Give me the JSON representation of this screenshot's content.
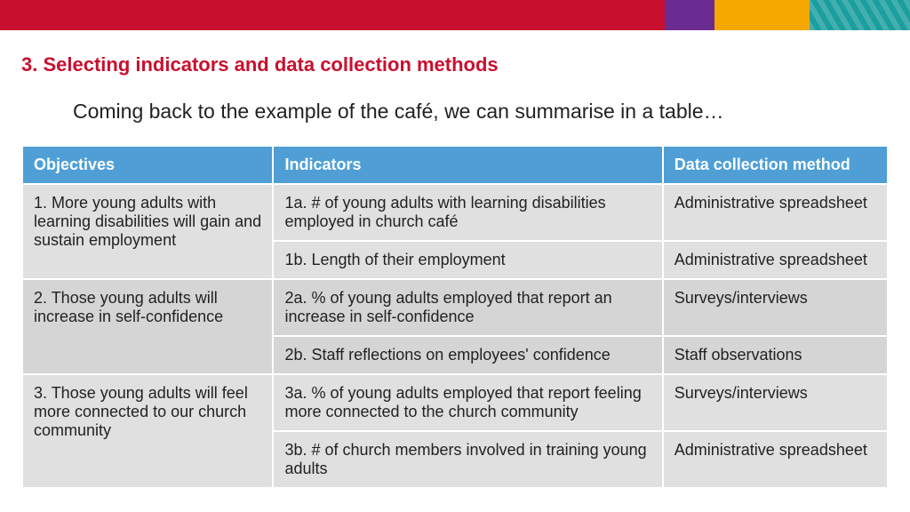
{
  "header": {
    "title": "3. Selecting indicators and data collection methods",
    "intro": "Coming back to the example of the café, we can summarise in a table…"
  },
  "table": {
    "columns": [
      "Objectives",
      "Indicators",
      "Data collection method"
    ],
    "groups": [
      {
        "objective": "1. More young adults with learning disabilities will gain and sustain employment",
        "rows": [
          {
            "indicator": "1a. # of young adults with learning disabilities employed in church café",
            "method": "Administrative spreadsheet"
          },
          {
            "indicator": "1b. Length of their employment",
            "method": "Administrative spreadsheet"
          }
        ]
      },
      {
        "objective": "2. Those young adults will increase in self-confidence",
        "rows": [
          {
            "indicator": "2a. % of young adults employed that report an increase in self-confidence",
            "method": "Surveys/interviews"
          },
          {
            "indicator": "2b. Staff reflections on employees' confidence",
            "method": "Staff observations"
          }
        ]
      },
      {
        "objective": "3. Those young adults will feel more connected to our church community",
        "rows": [
          {
            "indicator": "3a. % of young adults employed that report feeling more connected to the church community",
            "method": "Surveys/interviews"
          },
          {
            "indicator": "3b. # of church members involved in training young adults",
            "method": "Administrative spreadsheet"
          }
        ]
      }
    ]
  }
}
